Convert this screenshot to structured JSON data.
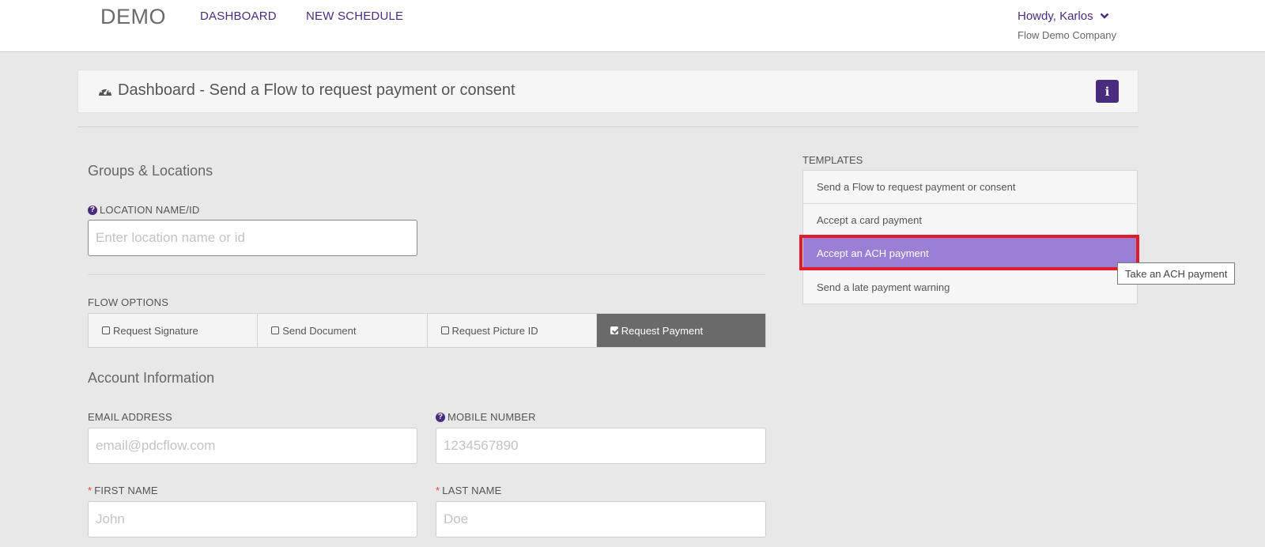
{
  "nav": {
    "brand": "DEMO",
    "links": [
      "DASHBOARD",
      "NEW SCHEDULE"
    ],
    "user_greeting": "Howdy, Karlos",
    "company": "Flow Demo Company"
  },
  "dashboard": {
    "title": "Dashboard - Send a Flow to request payment or consent",
    "info_icon": "i"
  },
  "groups": {
    "heading": "Groups & Locations",
    "location_label": "LOCATION NAME/ID",
    "location_placeholder": "Enter location name or id"
  },
  "flow_options": {
    "label": "FLOW OPTIONS",
    "options": [
      {
        "label": "Request Signature",
        "checked": false
      },
      {
        "label": "Send Document",
        "checked": false
      },
      {
        "label": "Request Picture ID",
        "checked": false
      },
      {
        "label": "Request Payment",
        "checked": true
      }
    ]
  },
  "account": {
    "heading": "Account Information",
    "email_label": "EMAIL ADDRESS",
    "email_placeholder": "email@pdcflow.com",
    "mobile_label": "MOBILE NUMBER",
    "mobile_placeholder": "1234567890",
    "first_name_label": "FIRST NAME",
    "first_name_placeholder": "John",
    "last_name_label": "LAST NAME",
    "last_name_placeholder": "Doe",
    "required_mark": "*"
  },
  "templates": {
    "label": "TEMPLATES",
    "items": [
      "Send a Flow to request payment or consent",
      "Accept a card payment",
      "Accept an ACH payment",
      "Send a late payment warning"
    ],
    "tooltip": "Take an ACH payment"
  },
  "colors": {
    "accent": "#4a2c7f",
    "template_hover": "#9b7fd4",
    "highlight": "#e21b2b",
    "active_option": "#6a6a6a"
  }
}
